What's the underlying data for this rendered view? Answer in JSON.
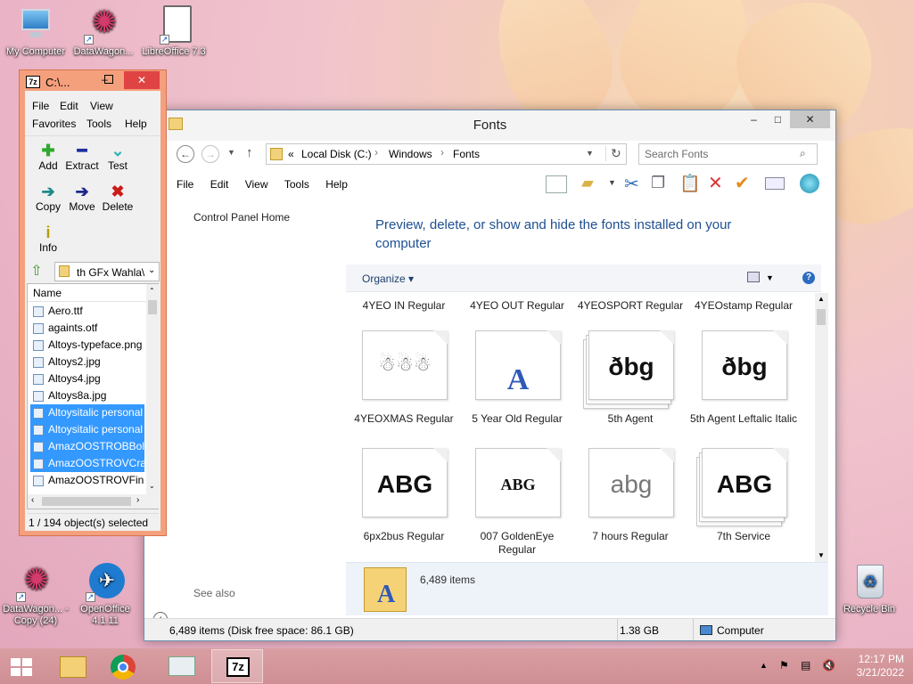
{
  "desktop": {
    "icons": [
      {
        "label": "My Computer",
        "icon": "computer-icon"
      },
      {
        "label": "DataWagon...",
        "icon": "datawagon-icon"
      },
      {
        "label": "LibreOffice 7.3",
        "icon": "libreoffice-icon"
      },
      {
        "label": "DataWagon... - Copy (24)",
        "icon": "datawagon-icon"
      },
      {
        "label": "OpenOffice 4.1.11",
        "icon": "openoffice-icon"
      },
      {
        "label": "Recycle Bin",
        "icon": "recycle-bin-icon"
      }
    ]
  },
  "fonts_window": {
    "title": "Fonts",
    "minimize": "–",
    "maximize": "□",
    "close": "✕",
    "breadcrumb": [
      "«",
      "Local Disk (C:)",
      "Windows",
      "Fonts"
    ],
    "search_placeholder": "Search Fonts",
    "menu": [
      "File",
      "Edit",
      "View",
      "Tools",
      "Help"
    ],
    "left_links": {
      "home": "Control Panel Home",
      "see_also": "See also"
    },
    "heading": "Preview, delete, or show and hide the fonts installed on your computer",
    "organize_label": "Organize ▾",
    "fonts_top": [
      "4YEO IN Regular",
      "4YEO OUT Regular",
      "4YEOSPORT Regular",
      "4YEOstamp Regular"
    ],
    "fonts": [
      {
        "name": "4YEOXMAS Regular",
        "sample": "☃☃☃",
        "stack": false
      },
      {
        "name": "5 Year Old Regular",
        "sample": "A",
        "stack": false
      },
      {
        "name": "5th Agent",
        "sample": "ðbg",
        "stack": true
      },
      {
        "name": "5th Agent Leftalic Italic",
        "sample": "ðbg",
        "stack": false
      },
      {
        "name": "6px2bus Regular",
        "sample": "ABG",
        "stack": false
      },
      {
        "name": "007 GoldenEye Regular",
        "sample": "ABG",
        "stack": false
      },
      {
        "name": "7 hours Regular",
        "sample": "abg",
        "stack": false
      },
      {
        "name": "7th Service",
        "sample": "ABG",
        "stack": true
      }
    ],
    "details_count": "6,489 items",
    "status_items": "6,489 items (Disk free space: 86.1 GB)",
    "status_size": "1.38 GB",
    "status_location": "Computer"
  },
  "sevenzip_window": {
    "title": "C:\\...",
    "app_icon": "7z",
    "menu_row1": [
      "File",
      "Edit",
      "View"
    ],
    "menu_row2": [
      "Favorites",
      "Tools",
      "Help"
    ],
    "buttons": [
      {
        "label": "Add",
        "icon": "add-icon",
        "glyph": "✚",
        "color": "#2fa82f"
      },
      {
        "label": "Extract",
        "icon": "extract-icon",
        "glyph": "━",
        "color": "#1d2fa0"
      },
      {
        "label": "Test",
        "icon": "test-icon",
        "glyph": "⌄",
        "color": "#2bb6b6"
      },
      {
        "label": "Copy",
        "icon": "copy-arrow-icon",
        "glyph": "➔",
        "color": "#1f8a8a"
      },
      {
        "label": "Move",
        "icon": "move-arrow-icon",
        "glyph": "➔",
        "color": "#1d2a8c"
      },
      {
        "label": "Delete",
        "icon": "delete-icon",
        "glyph": "✖",
        "color": "#cc1a1a"
      },
      {
        "label": "Info",
        "icon": "info-icon",
        "glyph": "i",
        "color": "#b89b00"
      }
    ],
    "path": "th GFx Wahla\\",
    "column_name": "Name",
    "files": [
      {
        "name": "Aero.ttf",
        "selected": false
      },
      {
        "name": "againts.otf",
        "selected": false
      },
      {
        "name": "Altoys-typeface.png",
        "selected": false
      },
      {
        "name": "Altoys2.jpg",
        "selected": false
      },
      {
        "name": "Altoys4.jpg",
        "selected": false
      },
      {
        "name": "Altoys8a.jpg",
        "selected": false
      },
      {
        "name": "Altoysitalic personal",
        "selected": true
      },
      {
        "name": "Altoysitalic personal",
        "selected": true
      },
      {
        "name": "AmazOOSTROBBold",
        "selected": true
      },
      {
        "name": "AmazOOSTROVCraz",
        "selected": true
      },
      {
        "name": "AmazOOSTROVFine.",
        "selected": false
      }
    ],
    "status": "1 / 194 object(s) selected"
  },
  "taskbar": {
    "start_icon": "windows-start-icon",
    "items": [
      "file-explorer-icon",
      "chrome-icon",
      "resource-monitor-icon",
      "7zip-icon"
    ],
    "time": "12:17 PM",
    "date": "3/21/2022"
  },
  "colors": {
    "accent_link": "#1e4f91",
    "selection": "#3399ff",
    "sevenzip_frame": "#f5a07d",
    "taskbar": "#d39599"
  }
}
